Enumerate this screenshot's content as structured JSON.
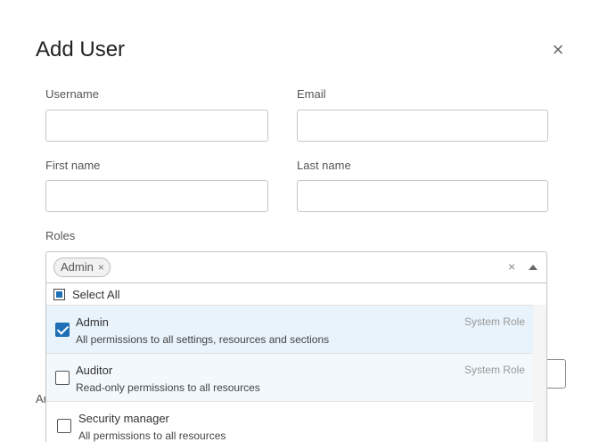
{
  "dialog": {
    "title": "Add User",
    "close_glyph": "×"
  },
  "form": {
    "username": {
      "label": "Username",
      "value": ""
    },
    "email": {
      "label": "Email",
      "value": ""
    },
    "first_name": {
      "label": "First name",
      "value": ""
    },
    "last_name": {
      "label": "Last name",
      "value": ""
    },
    "roles": {
      "label": "Roles",
      "selected_chips": [
        "Admin"
      ],
      "chip_remove_glyph": "×",
      "clear_glyph": "×",
      "select_all_label": "Select All",
      "options": [
        {
          "name": "Admin",
          "description": "All permissions to all settings, resources and sections",
          "tag": "System Role",
          "checked": true
        },
        {
          "name": "Auditor",
          "description": "Read-only permissions to all resources",
          "tag": "System Role",
          "checked": false
        },
        {
          "name": "Security manager",
          "description": "All permissions to all resources",
          "tag": "",
          "checked": false
        }
      ]
    }
  },
  "background": {
    "partial_text": "Ar"
  },
  "colors": {
    "accent": "#1f6fb5",
    "selected_row": "#e8f3fb"
  }
}
